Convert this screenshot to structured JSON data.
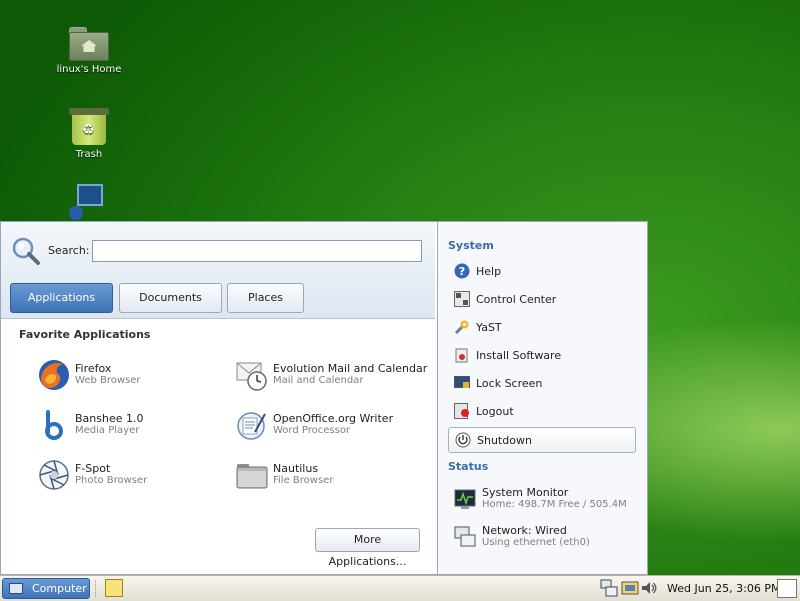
{
  "desktop": {
    "icons": [
      {
        "label": "linux's Home"
      },
      {
        "label": "Trash"
      }
    ]
  },
  "menu": {
    "search": {
      "label": "Search:",
      "value": ""
    },
    "tabs": [
      {
        "label": "Applications",
        "active": true
      },
      {
        "label": "Documents",
        "active": false
      },
      {
        "label": "Places",
        "active": false
      }
    ],
    "favorites_title": "Favorite Applications",
    "apps": [
      {
        "name": "Firefox",
        "desc": "Web Browser",
        "icon": "firefox-icon"
      },
      {
        "name": "Evolution Mail and Calendar",
        "desc": "Mail and Calendar",
        "icon": "evolution-icon"
      },
      {
        "name": "Banshee 1.0",
        "desc": "Media Player",
        "icon": "banshee-icon"
      },
      {
        "name": "OpenOffice.org Writer",
        "desc": "Word Processor",
        "icon": "writer-icon"
      },
      {
        "name": "F-Spot",
        "desc": "Photo Browser",
        "icon": "fspot-icon"
      },
      {
        "name": "Nautilus",
        "desc": "File Browser",
        "icon": "nautilus-icon"
      }
    ],
    "more_button": "More Applications...",
    "system_title": "System",
    "system_items": [
      {
        "label": "Help",
        "icon": "help-icon"
      },
      {
        "label": "Control Center",
        "icon": "control-center-icon"
      },
      {
        "label": "YaST",
        "icon": "yast-icon"
      },
      {
        "label": "Install Software",
        "icon": "install-software-icon"
      },
      {
        "label": "Lock Screen",
        "icon": "lock-screen-icon"
      },
      {
        "label": "Logout",
        "icon": "logout-icon"
      },
      {
        "label": "Shutdown",
        "icon": "shutdown-icon"
      }
    ],
    "status_title": "Status",
    "status_items": [
      {
        "title": "System Monitor",
        "desc": "Home: 498.7M Free / 505.4M",
        "icon": "system-monitor-icon"
      },
      {
        "title": "Network: Wired",
        "desc": "Using ethernet (eth0)",
        "icon": "network-icon"
      }
    ]
  },
  "taskbar": {
    "computer_label": "Computer",
    "clock": "Wed Jun 25,  3:06 PM"
  },
  "colors": {
    "accent": "#3f73b8",
    "section_heading": "#3a6ea5"
  }
}
